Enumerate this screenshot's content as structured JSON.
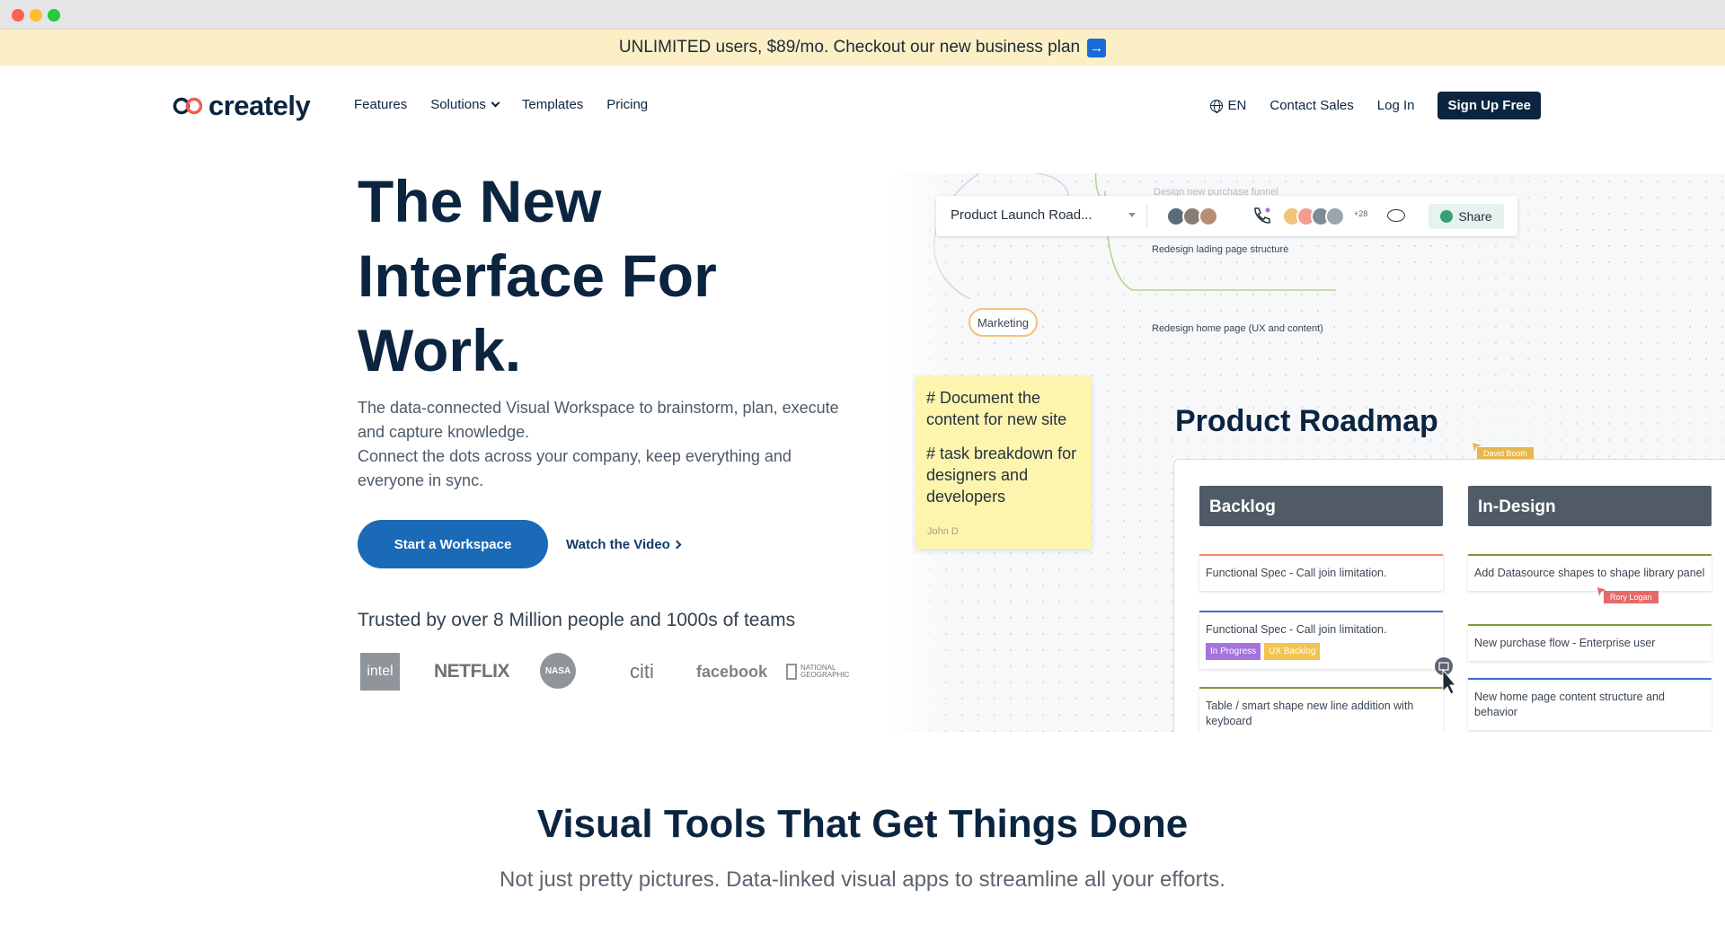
{
  "banner": {
    "text": "UNLIMITED users, $89/mo. Checkout our new business plan",
    "arrow": "→"
  },
  "nav": {
    "logo": "creately",
    "links": [
      "Features",
      "Solutions",
      "Templates",
      "Pricing"
    ],
    "language": "EN",
    "contact": "Contact Sales",
    "login": "Log In",
    "signup": "Sign Up Free"
  },
  "hero": {
    "title": [
      "The New",
      "Interface For",
      "Work."
    ],
    "desc1": "The data-connected Visual Workspace to brainstorm, plan, execute and capture knowledge.",
    "desc2": "Connect the dots across your company, keep everything and everyone in sync.",
    "cta": "Start a Workspace",
    "video": "Watch the Video",
    "trusted": "Trusted by over 8 Million people and 1000s of teams",
    "logos": [
      "intel",
      "NETFLIX",
      "NASA",
      "citi",
      "facebook",
      "NATIONAL GEOGRAPHIC"
    ]
  },
  "illustration": {
    "doc_title": "Product Launch Road...",
    "more_count": "+28",
    "share": "Share",
    "mindmap": {
      "top_faded": "Design new purchase funnel",
      "item1": "Redesign lading page structure",
      "item2": "Redesign home page (UX and content)",
      "node": "Marketing"
    },
    "sticky": {
      "line1": "# Document the content for new site",
      "line2": "# task breakdown for designers and developers",
      "author": "John D"
    },
    "roadmap_title": "Product Roadmap",
    "cursor1": "David Booth",
    "cursor2": "Rory Logan",
    "columns": [
      {
        "name": "Backlog",
        "cards": [
          {
            "text": "Functional Spec - Call join limitation.",
            "tags": []
          },
          {
            "text": "Functional Spec - Call join limitation.",
            "tags": [
              "In Progress",
              "UX Backlog"
            ]
          },
          {
            "text": "Table / smart shape new line addition with keyboard",
            "tags": []
          }
        ]
      },
      {
        "name": "In-Design",
        "cards": [
          {
            "text": "Add Datasource shapes to shape library panel",
            "tags": []
          },
          {
            "text": "New purchase flow - Enterprise user",
            "tags": []
          },
          {
            "text": "New home page content structure and behavior",
            "tags": []
          }
        ]
      }
    ]
  },
  "section": {
    "title": "Visual Tools That Get Things Done",
    "subtitle": "Not just pretty pictures. Data-linked visual apps to streamline all your efforts."
  },
  "colors": {
    "navy": "#0b2540",
    "primary_blue": "#1a6ab8",
    "banner_bg": "#fcefc6",
    "sticky_bg": "#fdf5ae",
    "column_header": "#505b67",
    "tag_progress": "#a673dd",
    "tag_ux": "#f2c451"
  }
}
